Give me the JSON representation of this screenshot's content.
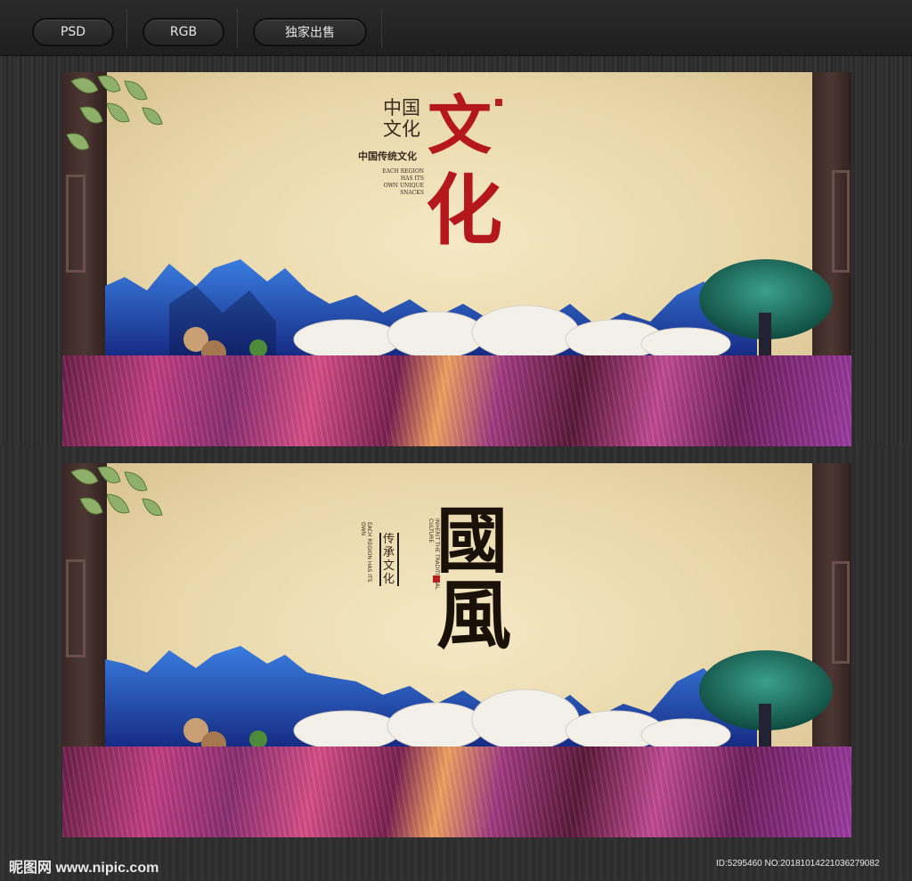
{
  "toolbar": {
    "buttons": [
      "PSD",
      "RGB",
      "独家出售"
    ]
  },
  "panel1": {
    "small_title_1": "中国",
    "small_title_2": "文化",
    "big_char_1": "文",
    "big_char_2": "化",
    "subtitle": "中国传统文化",
    "en_line_1": "EACH REGION",
    "en_line_2": "HAS ITS",
    "en_line_3": "OWN UNIQUE SNACKS"
  },
  "panel2": {
    "big_char_1": "國",
    "big_char_2": "風",
    "subtitle": "传承文化",
    "vertical_en_1": "EACH REGION HAS ITS OWN",
    "vertical_en_2": "INHERIT THE TRADITIONAL CULTURE"
  },
  "footer": {
    "logo": "昵图网 www.nipic.com",
    "id": "ID:5295460 NO:20181014221036279082"
  },
  "colors": {
    "accent_red": "#b4171c",
    "paper": "#efe0b6",
    "mountain_blue": "#2a4fc0",
    "tree_teal": "#1e6e63"
  }
}
